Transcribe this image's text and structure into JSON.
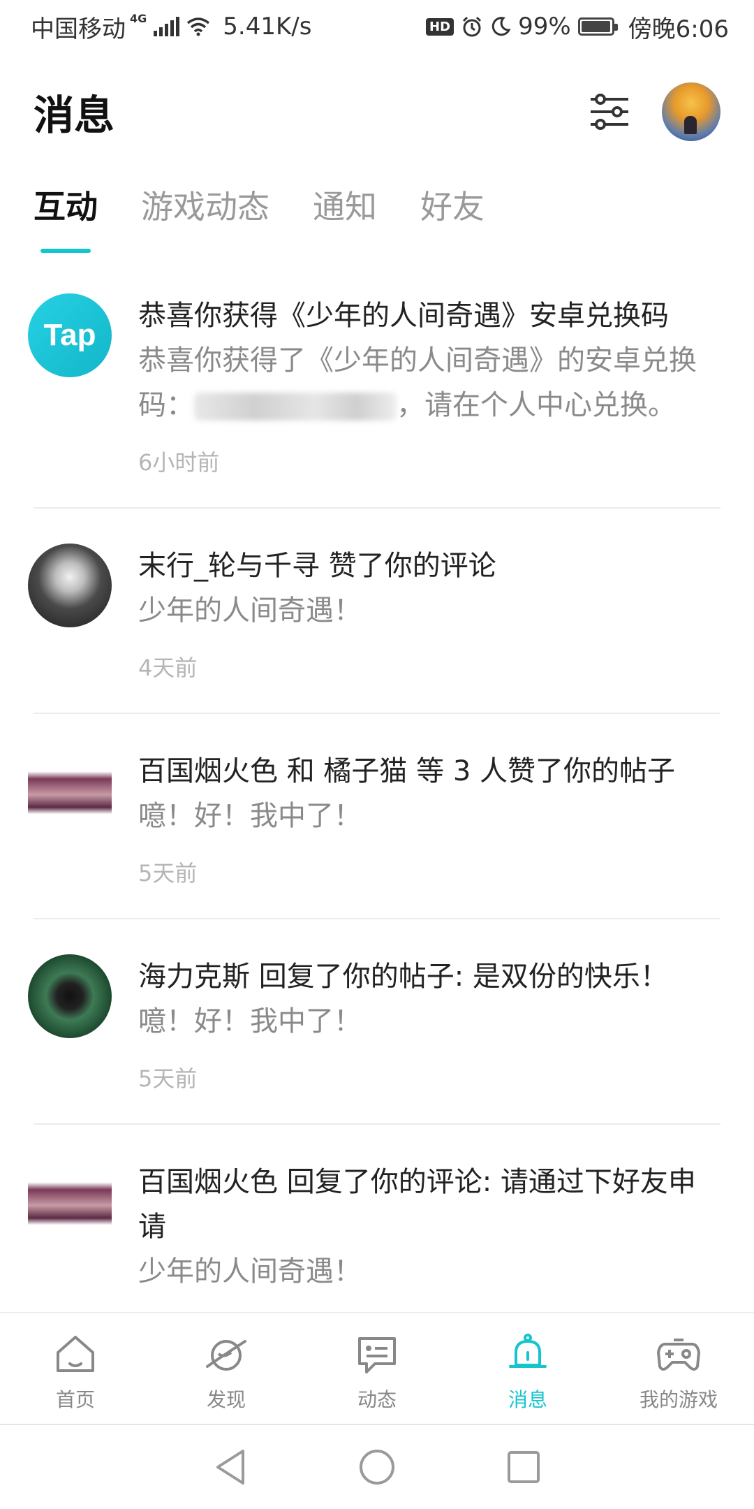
{
  "status_bar": {
    "carrier": "中国移动",
    "network": "4G",
    "speed": "5.41K/s",
    "hd": "HD",
    "battery": "99%",
    "battery_level": 0.99,
    "time": "傍晚6:06"
  },
  "header": {
    "title": "消息"
  },
  "tabs": [
    {
      "label": "互动",
      "active": true
    },
    {
      "label": "游戏动态",
      "active": false
    },
    {
      "label": "通知",
      "active": false
    },
    {
      "label": "好友",
      "active": false
    }
  ],
  "messages": [
    {
      "avatar": "Tap",
      "title": "恭喜你获得《少年的人间奇遇》安卓兑换码",
      "desc_prefix": "恭喜你获得了《少年的人间奇遇》的安卓兑换码：",
      "desc_suffix": "，请在个人中心兑换。",
      "time": "6小时前"
    },
    {
      "title": "末行_轮与千寻 赞了你的评论",
      "desc": "少年的人间奇遇！",
      "time": "4天前"
    },
    {
      "title": "百国烟火色 和 橘子猫 等 3 人赞了你的帖子",
      "desc": "噫！好！我中了！",
      "time": "5天前"
    },
    {
      "title": "海力克斯 回复了你的帖子: 是双份的快乐！",
      "desc": "噫！好！我中了！",
      "time": "5天前"
    },
    {
      "title": "百国烟火色 回复了你的评论: 请通过下好友申请",
      "desc": "少年的人间奇遇！",
      "time": ""
    }
  ],
  "bottom_nav": [
    {
      "label": "首页",
      "icon": "home-icon"
    },
    {
      "label": "发现",
      "icon": "planet-icon"
    },
    {
      "label": "动态",
      "icon": "chat-icon"
    },
    {
      "label": "消息",
      "icon": "bell-icon",
      "active": true
    },
    {
      "label": "我的游戏",
      "icon": "gamepad-icon"
    }
  ],
  "colors": {
    "accent": "#15c5ce"
  }
}
